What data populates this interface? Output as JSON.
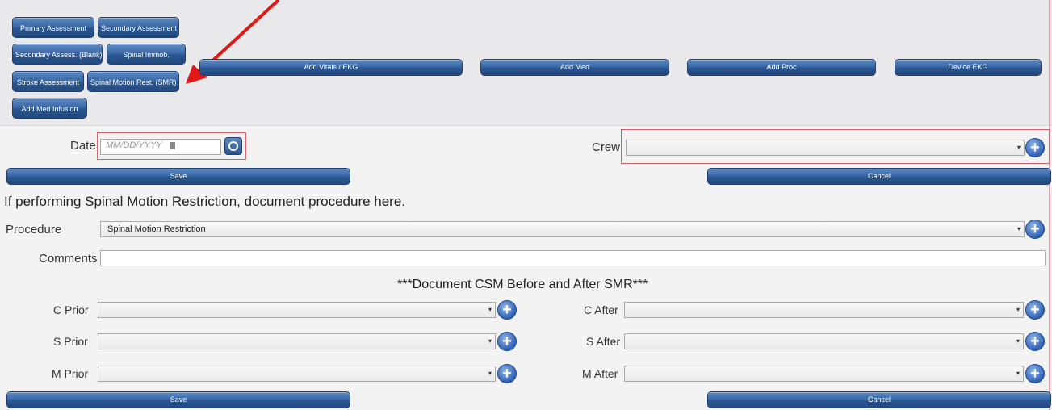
{
  "assessment_buttons": {
    "primary": "Primary Assessment",
    "secondary": "Secondary Assessment",
    "secondary_blank": "Secondary Assess. (Blank)",
    "spinal_immob": "Spinal Immob.",
    "stroke": "Stroke Assessment",
    "smr": "Spinal Motion Rest. (SMR)",
    "med_infusion": "Add Med Infusion"
  },
  "action_buttons": {
    "vitals": "Add Vitals / EKG",
    "med": "Add Med",
    "proc": "Add Proc",
    "device_ekg": "Device EKG"
  },
  "form": {
    "date_label": "Date",
    "date_placeholder": "MM/DD/YYYY",
    "crew_label": "Crew",
    "save_label": "Save",
    "cancel_label": "Cancel"
  },
  "smr": {
    "instruction": "If performing Spinal Motion Restriction, document procedure here.",
    "procedure_label": "Procedure",
    "procedure_value": "Spinal Motion Restriction",
    "comments_label": "Comments",
    "csm_heading": "***Document CSM Before and After SMR***",
    "c_prior": "C Prior",
    "s_prior": "S Prior",
    "m_prior": "M Prior",
    "c_after": "C After",
    "s_after": "S After",
    "m_after": "M After",
    "save_label": "Save",
    "cancel_label": "Cancel"
  },
  "colors": {
    "button_blue": "#3a69a8",
    "annotation_red": "#e01818",
    "highlight_box": "#d8606a"
  },
  "icons": {
    "plus": "+",
    "dropdown": "▾",
    "calendar": "clock-icon"
  }
}
